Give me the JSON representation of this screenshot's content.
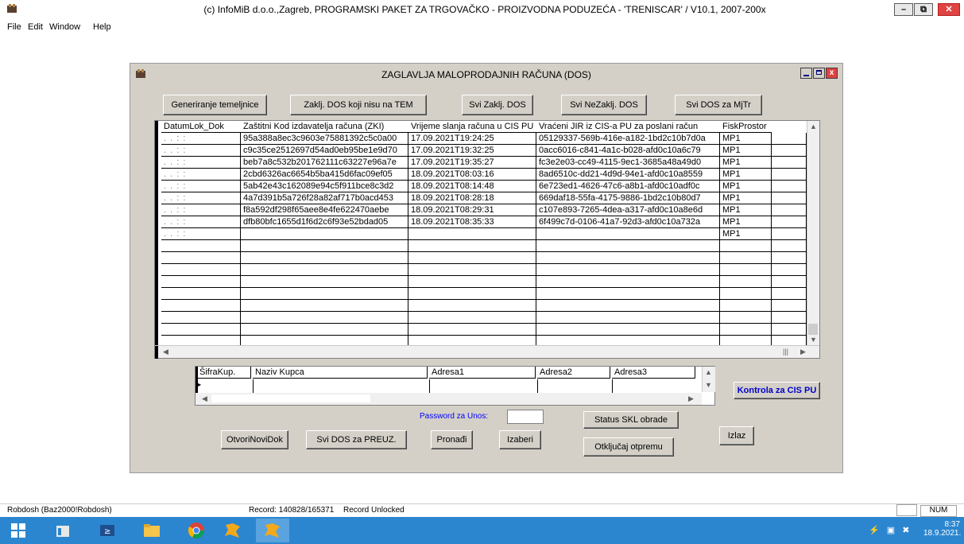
{
  "app": {
    "title": "(c) InfoMiB d.o.o.,Zagreb, PROGRAMSKI PAKET ZA TRGOVAČKO - PROIZVODNA PODUZEĆA - 'TRENISCAR' / V10.1, 2007-200x",
    "window_controls": {
      "minimize": "–",
      "restore": "⧉",
      "close": "✕"
    }
  },
  "menu": [
    "File",
    "Edit",
    "Window",
    "Help"
  ],
  "window": {
    "title": "ZAGLAVLJA MALOPRODAJNIH RAČUNA (DOS)"
  },
  "toolbar": {
    "generate": "Generiranje temeljnice",
    "closed_not_tem": "Zaklj. DOS koji nisu na TEM",
    "all_closed": "Svi Zaklj. DOS",
    "all_open": "Svi NeZaklj. DOS",
    "all_mjtr": "Svi DOS za MjTr"
  },
  "grid": {
    "columns": [
      "DatumLok_Dok",
      "Zaštitni Kod izdavatelja računa (ZKI)",
      "Vrijeme slanja računa u CIS PU",
      "Vraćeni JIR iz CIS-a PU za poslani račun",
      "FiskProstor"
    ],
    "empty_datetime": ". .     : :",
    "rows": [
      {
        "zki": "95a388a8ec3c9603e75881392c5c0a00",
        "time": "17.09.2021T19:24:25",
        "jir": "05129337-569b-416e-a182-1bd2c10b7d0a",
        "fisk": "MP1"
      },
      {
        "zki": "c9c35ce2512697d54ad0eb95be1e9d70",
        "time": "17.09.2021T19:32:25",
        "jir": "0acc6016-c841-4a1c-b028-afd0c10a6c79",
        "fisk": "MP1"
      },
      {
        "zki": "beb7a8c532b201762111c63227e96a7e",
        "time": "17.09.2021T19:35:27",
        "jir": "fc3e2e03-cc49-4115-9ec1-3685a48a49d0",
        "fisk": "MP1"
      },
      {
        "zki": "2cbd6326ac6654b5ba415d6fac09ef05",
        "time": "18.09.2021T08:03:16",
        "jir": "8ad6510c-dd21-4d9d-94e1-afd0c10a8559",
        "fisk": "MP1"
      },
      {
        "zki": "5ab42e43c162089e94c5f911bce8c3d2",
        "time": "18.09.2021T08:14:48",
        "jir": "6e723ed1-4626-47c6-a8b1-afd0c10adf0c",
        "fisk": "MP1"
      },
      {
        "zki": "4a7d391b5a726f28a82af717b0acd453",
        "time": "18.09.2021T08:28:18",
        "jir": "669daf18-55fa-4175-9886-1bd2c10b80d7",
        "fisk": "MP1"
      },
      {
        "zki": "f8a592df298f65aee8e4fe622470aebe",
        "time": "18.09.2021T08:29:31",
        "jir": "c107e893-7265-4dea-a317-afd0c10a8e6d",
        "fisk": "MP1"
      },
      {
        "zki": "dfb80bfc1655d1f6d2c6f93e52bdad05",
        "time": "18.09.2021T08:35:33",
        "jir": "6f499c7d-0106-41a7-92d3-afd0c10a732a",
        "fisk": "MP1"
      },
      {
        "zki": "",
        "time": "",
        "jir": "",
        "fisk": "MP1"
      }
    ]
  },
  "customer_grid": {
    "columns": [
      "ŠifraKup.",
      "Naziv Kupca",
      "Adresa1",
      "Adresa2",
      "Adresa3"
    ]
  },
  "buttons": {
    "cis_control": "Kontrola za CIS PU",
    "password_label": "Password za Unos:",
    "status_skl": "Status SKL obrade",
    "unlock": "Otključaj otpremu",
    "exit": "Izlaz",
    "new_doc": "OtvoriNoviDok",
    "all_preuz": "Svi DOS za  PREUZ.",
    "find": "Pronađi",
    "choose": "Izaberi"
  },
  "status": {
    "db": "Robdosh (Baz2000!Robdosh)",
    "record": "Record: 140828/165371",
    "lock": "Record Unlocked",
    "num": "NUM"
  },
  "taskbar": {
    "time": "8:37",
    "date": "18.9.2021.",
    "icons": [
      "windows-start-icon",
      "file-explorer-icon",
      "powershell-icon",
      "folder-icon",
      "chrome-icon",
      "app-icon",
      "app-icon"
    ]
  }
}
